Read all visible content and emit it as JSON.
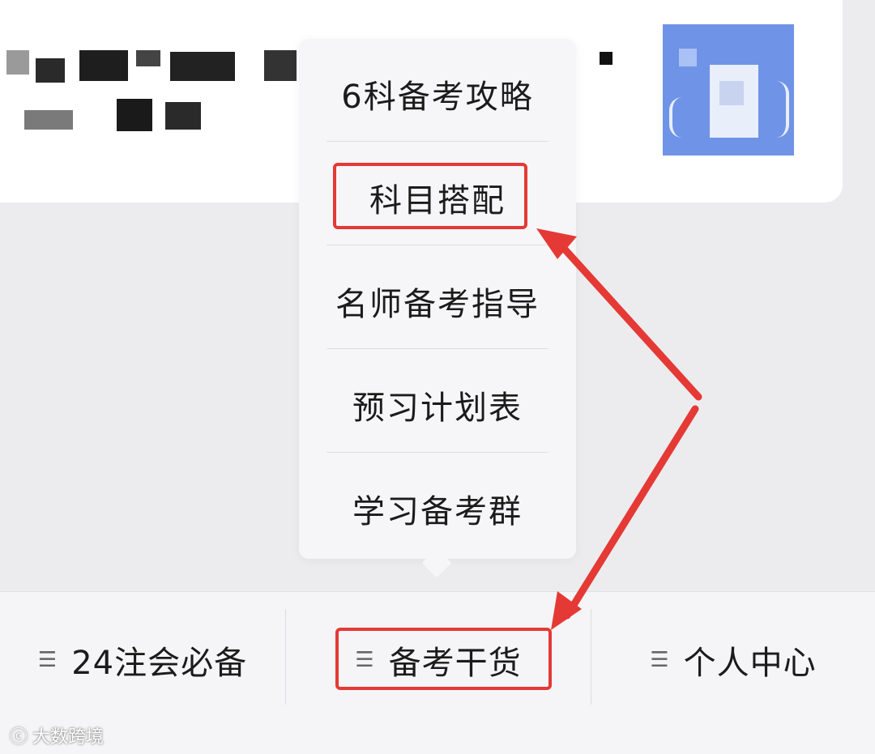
{
  "menu": {
    "items": [
      {
        "label": "6科备考攻略"
      },
      {
        "label": "科目搭配",
        "highlighted": true
      },
      {
        "label": "名师备考指导"
      },
      {
        "label": "预习计划表"
      },
      {
        "label": "学习备考群"
      }
    ]
  },
  "tabbar": {
    "tabs": [
      {
        "icon": "menu-icon",
        "label": "24注会必备"
      },
      {
        "icon": "menu-icon",
        "label": "备考干货",
        "highlighted": true
      },
      {
        "icon": "menu-icon",
        "label": "个人中心"
      }
    ]
  },
  "watermark": {
    "text": "大数跨境"
  },
  "colors": {
    "annotation": "#e53935",
    "background": "#ececee",
    "avatar": "#6f93e6"
  }
}
